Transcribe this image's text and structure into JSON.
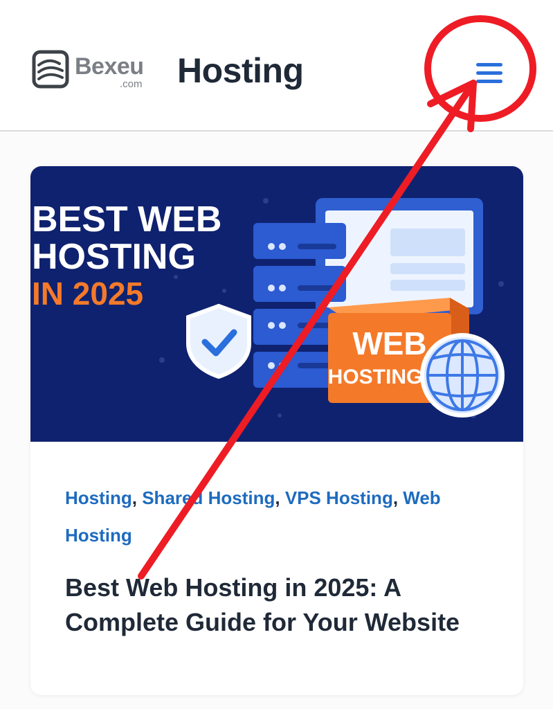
{
  "header": {
    "logo_word": "Bexeu",
    "logo_tld": ".com",
    "site_title": "Hosting",
    "menu_icon": "hamburger-menu-icon"
  },
  "hero_image": {
    "headline_line1": "BEST WEB",
    "headline_line2": "HOSTING",
    "headline_line3": "IN 2025",
    "box_label_line1": "WEB",
    "box_label_line2": "HOSTING",
    "icons": [
      "server-stack-icon",
      "browser-window-icon",
      "shield-check-icon",
      "globe-icon"
    ]
  },
  "post": {
    "categories": [
      "Hosting",
      "Shared Hosting",
      "VPS Hosting",
      "Web Hosting"
    ],
    "separator": ", ",
    "title": "Best Web Hosting in 2025: A Complete Guide for Your Website"
  },
  "colors": {
    "accent_blue": "#2a6fdb",
    "link_blue": "#1e6bbf",
    "hero_bg": "#0f2270",
    "hero_orange": "#f47a2a",
    "annotation_red": "#ee1c25"
  }
}
